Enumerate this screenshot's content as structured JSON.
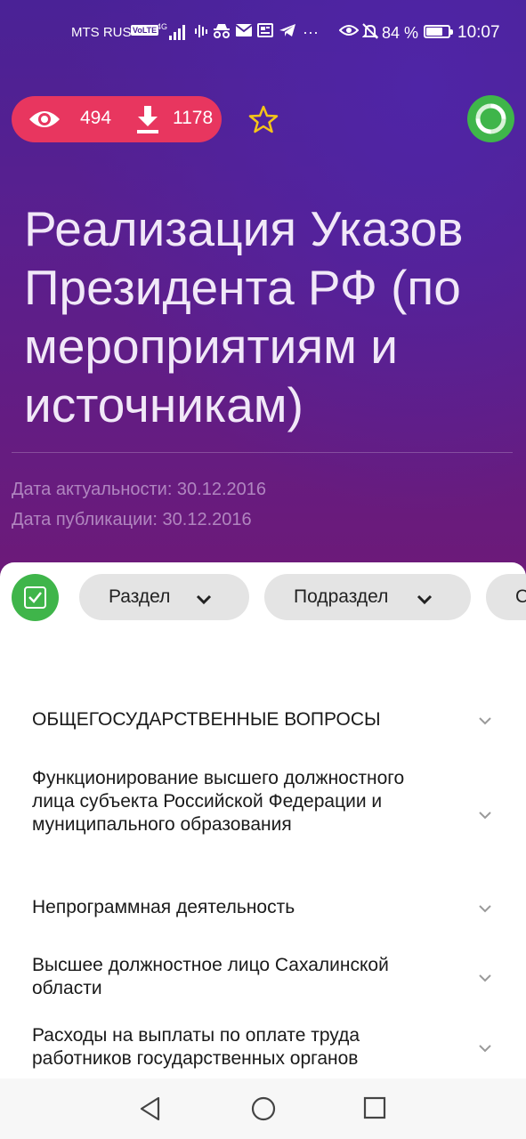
{
  "status_bar": {
    "carrier": "MTS RUS",
    "volte": "VoLTE",
    "network": "4G",
    "battery_percent_text": "84 %",
    "battery_level": 0.84,
    "time": "10:07",
    "icons": [
      "signal-icon",
      "podcast-icon",
      "incognito-icon",
      "mail-icon",
      "news-icon",
      "telegram-icon",
      "more-icon",
      "eye-icon",
      "notifications-off-icon",
      "battery-icon"
    ]
  },
  "stats": {
    "views": "494",
    "downloads": "1178",
    "views_icon": "eye-icon",
    "downloads_icon": "download-icon"
  },
  "favorite_icon": "star-outline-icon",
  "status_indicator_icon": "circle-progress-icon",
  "title": "Реализация Указов Президента РФ (по мероприятиям и источникам)",
  "meta": {
    "relevance": "Дата актуальности: 30.12.2016",
    "published": "Дата публикации: 30.12.2016"
  },
  "filters": {
    "select_all_icon": "checkbox-checked-icon",
    "chips": [
      {
        "label": "Раздел"
      },
      {
        "label": "Подраздел"
      },
      {
        "label": "С"
      }
    ]
  },
  "rows": [
    {
      "label": "ОБЩЕГОСУДАРСТВЕННЫЕ ВОПРОСЫ"
    },
    {
      "label": "Функционирование высшего должностного лица субъекта Российской Федерации и муниципального образования"
    },
    {
      "label": "Непрограммная деятельность"
    },
    {
      "label": "Высшее должностное лицо Сахалинской области"
    },
    {
      "label": "Расходы на выплаты по оплате труда работников государственных органов"
    }
  ],
  "navbar": {
    "icons": [
      "back-icon",
      "home-icon",
      "recents-icon"
    ]
  },
  "colors": {
    "hero_top": "#4a2296",
    "hero_bottom": "#6d1a78",
    "stats_pill": "#e8365f",
    "star": "#f5c518",
    "green": "#3fb54a",
    "chip_bg": "#e4e4e4"
  }
}
